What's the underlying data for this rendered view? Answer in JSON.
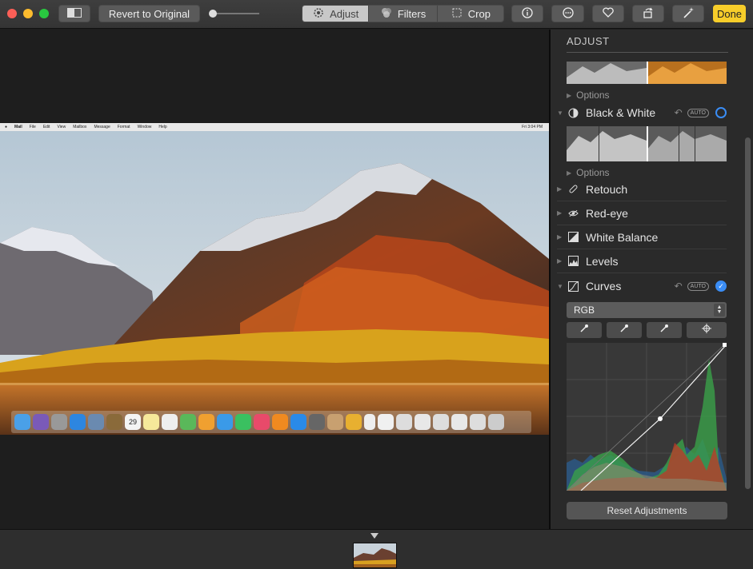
{
  "toolbar": {
    "revert_label": "Revert to Original",
    "tabs": [
      {
        "label": "Adjust",
        "icon": "adjust-dial-icon",
        "active": true
      },
      {
        "label": "Filters",
        "icon": "filters-icon",
        "active": false
      },
      {
        "label": "Crop",
        "icon": "crop-icon",
        "active": false
      }
    ],
    "info_icon": "info-icon",
    "more_icon": "more-ellipsis-icon",
    "favorite_icon": "heart-icon",
    "rotate_icon": "rotate-icon",
    "enhance_icon": "magic-wand-icon",
    "done_label": "Done",
    "done_color": "#f7cd2a"
  },
  "photo": {
    "menubar_items": [
      "Mail",
      "File",
      "Edit",
      "View",
      "Mailbox",
      "Message",
      "Format",
      "Window",
      "Help"
    ],
    "clock": "Fri 3:04 PM",
    "calendar_day": "29"
  },
  "sidebar": {
    "title": "ADJUST",
    "options_label": "Options",
    "sections": [
      {
        "label": "Black & White",
        "icon": "black-white-icon",
        "auto": "AUTO",
        "enabled": false
      },
      {
        "label": "Retouch",
        "icon": "bandage-icon"
      },
      {
        "label": "Red-eye",
        "icon": "eye-icon"
      },
      {
        "label": "White Balance",
        "icon": "white-balance-icon"
      },
      {
        "label": "Levels",
        "icon": "levels-icon"
      },
      {
        "label": "Curves",
        "icon": "curves-icon",
        "auto": "AUTO",
        "enabled": true
      }
    ],
    "channel_select": "RGB",
    "accent_color": "#3a8df5",
    "reset_label": "Reset Adjustments"
  }
}
